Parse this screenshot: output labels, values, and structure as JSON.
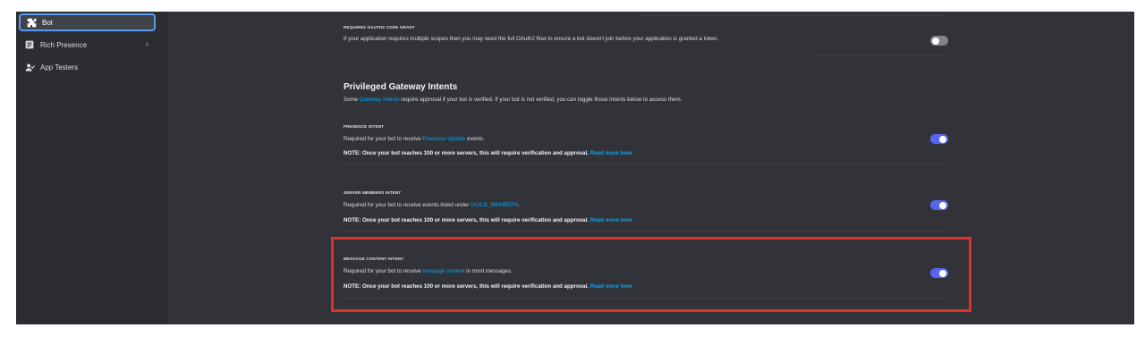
{
  "sidebar": {
    "items": [
      {
        "label": "Bot",
        "icon": "puzzle-icon",
        "active": true
      },
      {
        "label": "Rich Presence",
        "icon": "document-icon",
        "has_chevron": true
      },
      {
        "label": "App Testers",
        "icon": "user-check-icon"
      }
    ],
    "chevron": "›"
  },
  "oauth": {
    "label": "REQUIRES OAUTH2 CODE GRANT",
    "description": "If your application requires multiple scopes then you may need the full OAuth2 flow to ensure a bot doesn't join before your application is granted a token.",
    "toggle_on": false
  },
  "intents": {
    "title": "Privileged Gateway Intents",
    "subtitle_pre": "Some ",
    "subtitle_link": "Gateway Intents",
    "subtitle_post": " require approval if your bot is verified. If your bot is not verified, you can toggle those intents below to access them."
  },
  "presence": {
    "label": "PRESENCE INTENT",
    "desc_pre": "Required for your bot to receive ",
    "desc_link": "Presence Update",
    "desc_post": " events.",
    "note": "NOTE: Once your bot reaches 100 or more servers, this will require verification and approval. ",
    "note_link": "Read more here",
    "toggle_on": true
  },
  "members": {
    "label": "SERVER MEMBERS INTENT",
    "desc_pre": "Required for your bot to receive events listed under ",
    "desc_link": "GUILD_MEMBERS",
    "desc_post": ".",
    "note": "NOTE: Once your bot reaches 100 or more servers, this will require verification and approval. ",
    "note_link": "Read more here",
    "toggle_on": true
  },
  "message": {
    "label": "MESSAGE CONTENT INTENT",
    "desc_pre": "Required for your bot to receive ",
    "desc_link": "message content",
    "desc_post": " in most messages.",
    "note": "NOTE: Once your bot reaches 100 or more servers, this will require verification and approval. ",
    "note_link": "Read more here",
    "toggle_on": true
  },
  "colors": {
    "accent": "#5865f2",
    "link": "#00a8fc",
    "highlight": "#d8342c"
  }
}
